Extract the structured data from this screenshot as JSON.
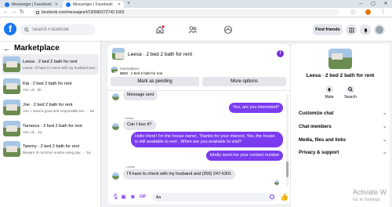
{
  "browser": {
    "tabs": [
      {
        "title": "Messenger | Facebook",
        "active": false
      },
      {
        "title": "Messenger | Facebook",
        "active": true
      }
    ],
    "new_tab": "+",
    "url": "facebook.com/messages/t/130990372742:1003"
  },
  "topbar": {
    "logo": "f",
    "search_placeholder": "Search Facebook",
    "find_friends": "Find friends",
    "accent": "#1877f2"
  },
  "sidebar": {
    "title": "Marketplace",
    "conversations": [
      {
        "title": "Leesa · 2 bed 2 bath for rent",
        "snippet": "Leesa: I'll have to check with my husband and... · 38m",
        "selected": true
      },
      {
        "title": "Kiä · 2 bed 2 bath for rent",
        "snippet": "You: ok · 5h",
        "selected": false
      },
      {
        "title": "Joe · 2 bed 2 bath for rent",
        "snippet": "You: I need a good and responsible ten... · 6d",
        "selected": false
      },
      {
        "title": "Tarrance · 2 bed 2 bath for rent",
        "snippet": "You: ok · 1w",
        "selected": false
      },
      {
        "title": "Tammy · 2 bed 2 bath for rent",
        "snippet": "Beware of common scams using pay... · 1w",
        "selected": false
      }
    ]
  },
  "chat": {
    "title": "Leesa · 2 bed 2 bath for rent",
    "listing_label": "Marketplace",
    "listing_price": "$600 · 2 bed 2 bath for rent",
    "mark_pending": "Mark as pending",
    "more_options": "More options",
    "messages": [
      {
        "from": "them",
        "sender": "",
        "text": "Message sent"
      },
      {
        "from": "me",
        "text": "Yes, are you interested?"
      },
      {
        "from": "them",
        "sender": "Leesa",
        "text": "Can I tour it?"
      },
      {
        "from": "me",
        "text": "Hello there! I'm the house owner, Thanks for your interest, Yes, the house is still available to rent , When are you available to visit?"
      },
      {
        "from": "me",
        "text": "kindly send me your contact number"
      },
      {
        "from": "them",
        "sender": "Leesa",
        "text": "I'll have to check with my husband and (256) 247-6301"
      }
    ],
    "composer_value": "Aa",
    "accent": "#7b3cf0"
  },
  "details": {
    "title": "Leesa · 2 bed 2 bath for rent",
    "mute": "Mute",
    "search": "Search",
    "sections": [
      "Customize chat",
      "Chat members",
      "Media, files and links",
      "Privacy & support"
    ]
  },
  "watermark": {
    "line1": "Activate W",
    "line2": "Go to Settings"
  }
}
